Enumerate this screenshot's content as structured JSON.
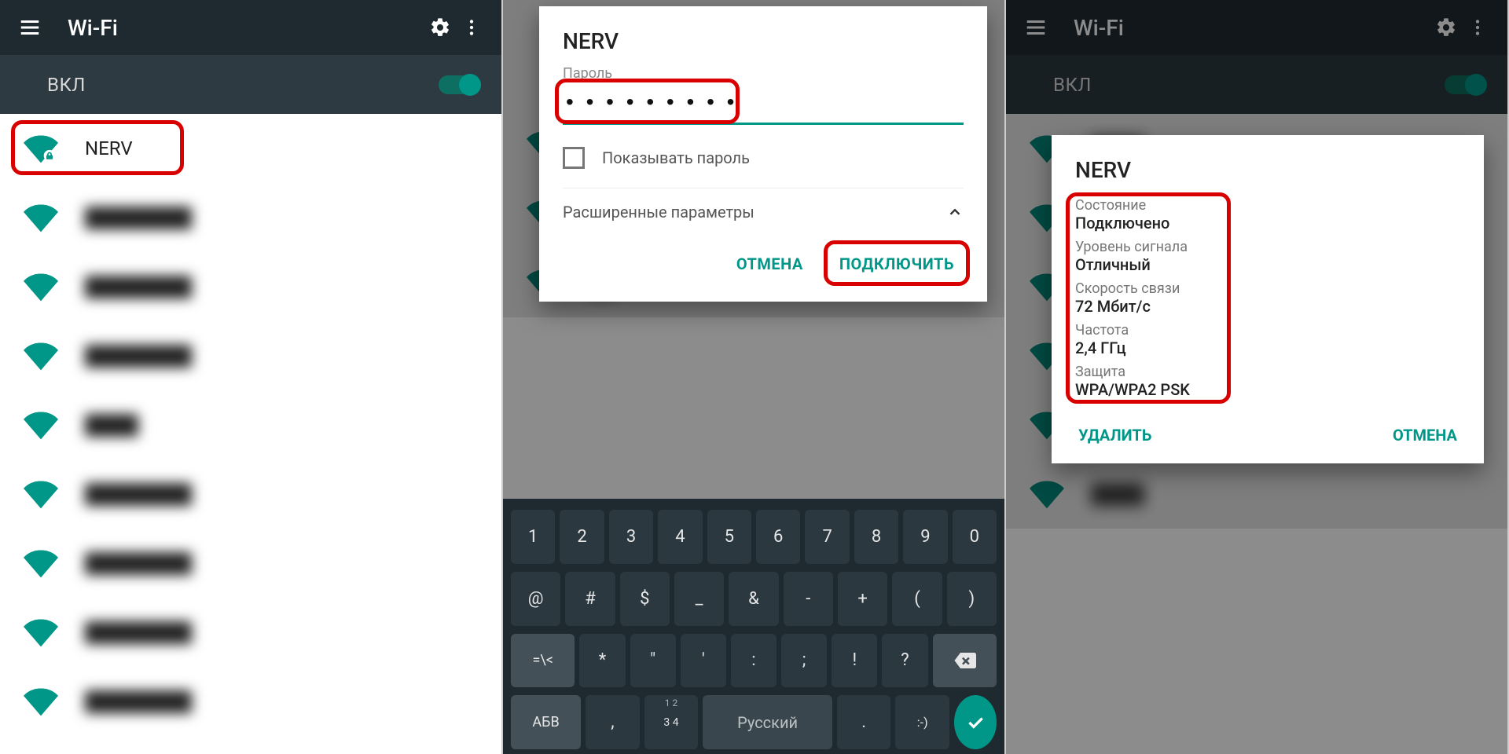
{
  "header": {
    "title": "Wi-Fi",
    "toggle_label": "ВКЛ"
  },
  "screen1": {
    "networks": [
      {
        "name": "NERV",
        "highlighted": true
      },
      {
        "name": "network"
      },
      {
        "name": "network"
      },
      {
        "name": "network"
      },
      {
        "name": "network"
      },
      {
        "name": "network"
      },
      {
        "name": "network"
      },
      {
        "name": "network"
      },
      {
        "name": "network"
      }
    ]
  },
  "dialog_connect": {
    "title": "NERV",
    "password_label": "Пароль",
    "password_value": "• • • • • • • • •",
    "show_pw_label": "Показывать пароль",
    "advanced_label": "Расширенные параметры",
    "cancel_label": "ОТМЕНА",
    "connect_label": "ПОДКЛЮЧИТЬ"
  },
  "dialog_details": {
    "title": "NERV",
    "fields": [
      {
        "lbl": "Состояние",
        "val": "Подключено"
      },
      {
        "lbl": "Уровень сигнала",
        "val": "Отличный"
      },
      {
        "lbl": "Скорость связи",
        "val": "72 Мбит/с"
      },
      {
        "lbl": "Частота",
        "val": "2,4 ГГц"
      },
      {
        "lbl": "Защита",
        "val": "WPA/WPA2 PSK"
      }
    ],
    "forget_label": "УДАЛИТЬ",
    "cancel_label": "ОТМЕНА"
  },
  "keyboard": {
    "row1": [
      "1",
      "2",
      "3",
      "4",
      "5",
      "6",
      "7",
      "8",
      "9",
      "0"
    ],
    "row2": [
      "@",
      "#",
      "$",
      "_",
      "&",
      "-",
      "+",
      "(",
      ")"
    ],
    "row3_sym": {
      "main": "=\\<",
      "sub": ""
    },
    "row3": [
      "*",
      "\"",
      "'",
      ":",
      ";",
      "!",
      "?"
    ],
    "row4_mode": "АБВ",
    "row4_num": {
      "main": "3 4",
      "sub": "1 2"
    },
    "row4_lang": "Русский",
    "row4_dot": ".",
    "row4_emoji": ":-)"
  },
  "colors": {
    "accent": "#009688",
    "appbar": "#1f2a30",
    "toggle_bg": "#2d3a41",
    "red": "#d90000"
  }
}
